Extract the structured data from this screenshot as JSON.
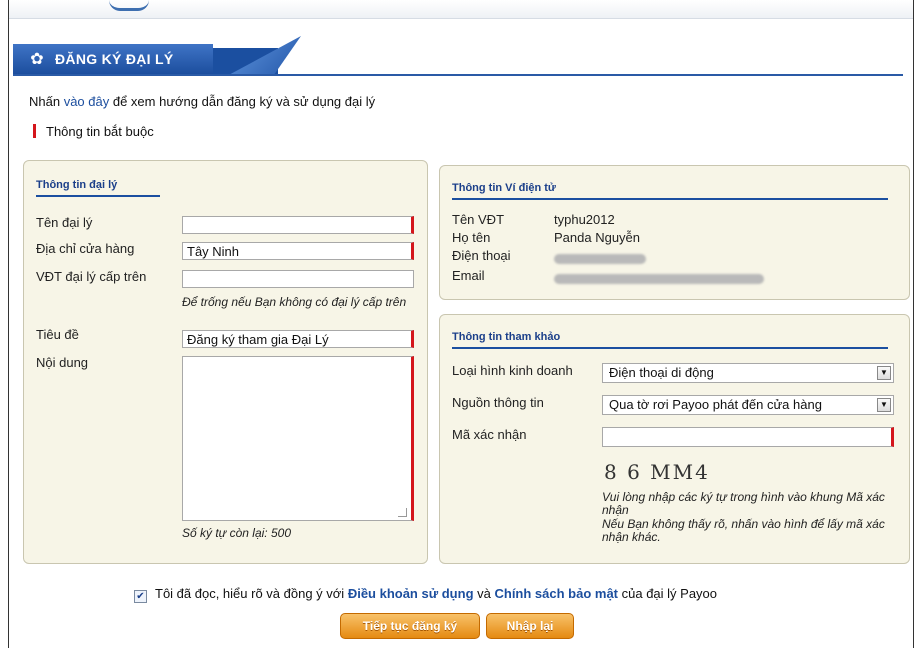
{
  "header": {
    "title": "ĐĂNG KÝ ĐẠI LÝ"
  },
  "intro": {
    "prefix": "Nhấn ",
    "link": "vào đây",
    "suffix": " để xem hướng dẫn đăng ký và sử dụng đại lý"
  },
  "required_note": "Thông tin bắt buộc",
  "agent_panel": {
    "title": "Thông tin đại lý",
    "name_label": "Tên đại lý",
    "name_value": "",
    "address_label": "Địa chỉ cửa hàng",
    "address_value": "Tây Ninh",
    "parent_label": "VĐT đại lý cấp trên",
    "parent_value": "",
    "parent_hint": "Để trống nếu Bạn không có đại lý cấp trên",
    "subject_label": "Tiêu đề",
    "subject_value": "Đăng ký tham gia Đại Lý",
    "content_label": "Nội dung",
    "content_value": "",
    "chars_left": "Số ký tự còn lại: 500"
  },
  "wallet_panel": {
    "title": "Thông tin Ví điện tử",
    "vdt_label": "Tên VĐT",
    "vdt_value": "typhu2012",
    "fullname_label": "Họ tên",
    "fullname_value": "Panda Nguyễn",
    "phone_label": "Điện thoại",
    "email_label": "Email"
  },
  "reference_panel": {
    "title": "Thông tin tham khảo",
    "business_label": "Loại hình kinh doanh",
    "business_value": "Điện thoại di động",
    "source_label": "Nguồn thông tin",
    "source_value": "Qua tờ rơi Payoo phát đến cửa hàng",
    "captcha_label": "Mã xác nhận",
    "captcha_value": "",
    "captcha_image_text": "8 6 MM4",
    "captcha_hint_1": "Vui lòng nhập các ký tự trong hình vào khung Mã xác nhận",
    "captcha_hint_2": "Nếu Bạn không thấy rõ, nhấn vào hình để lấy mã xác nhận khác."
  },
  "agreement": {
    "p1": "Tôi đã đọc, hiểu rõ và đồng ý với ",
    "terms": "Điều khoản sử dụng",
    "p2": " và ",
    "privacy": "Chính sách bảo mật",
    "p3": " của đại lý Payoo",
    "checked": true
  },
  "buttons": {
    "continue": "Tiếp tục đăng ký",
    "reset": "Nhập lại"
  },
  "colors": {
    "primary": "#1b4fa0",
    "required": "#d4161c",
    "panel_bg": "#f7f5e7",
    "button": "#e58a12"
  }
}
